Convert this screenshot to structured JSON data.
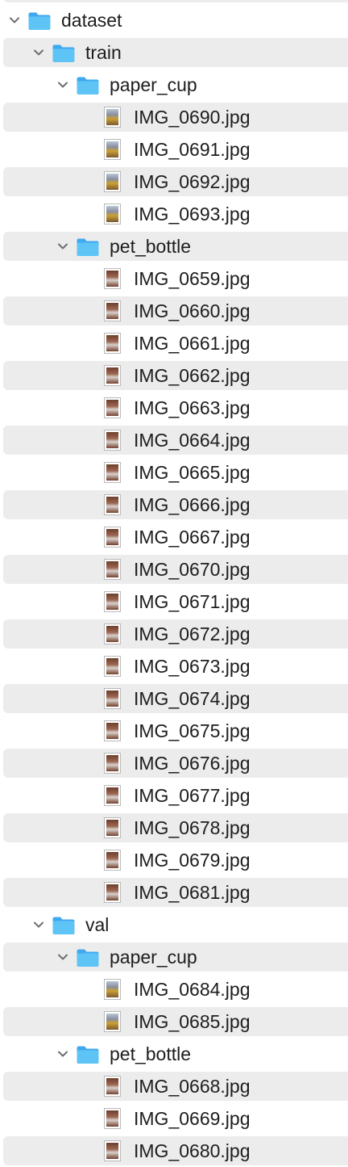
{
  "icons": {
    "folder": "folder-icon",
    "disclosure": "chevron-down-icon",
    "image": "image-thumbnail-icon"
  },
  "colors": {
    "folder": "#5ec4f5",
    "row_stripe": "#ececec",
    "text": "#1d1d1f"
  },
  "rows": [
    {
      "label": "dataset",
      "type": "folder",
      "depth": 0
    },
    {
      "label": "train",
      "type": "folder",
      "depth": 1
    },
    {
      "label": "paper_cup",
      "type": "folder",
      "depth": 2
    },
    {
      "label": "IMG_0690.jpg",
      "type": "file",
      "depth": 3,
      "thumb": "cup"
    },
    {
      "label": "IMG_0691.jpg",
      "type": "file",
      "depth": 3,
      "thumb": "cup"
    },
    {
      "label": "IMG_0692.jpg",
      "type": "file",
      "depth": 3,
      "thumb": "cup"
    },
    {
      "label": "IMG_0693.jpg",
      "type": "file",
      "depth": 3,
      "thumb": "cup"
    },
    {
      "label": "pet_bottle",
      "type": "folder",
      "depth": 2
    },
    {
      "label": "IMG_0659.jpg",
      "type": "file",
      "depth": 3,
      "thumb": "bottle"
    },
    {
      "label": "IMG_0660.jpg",
      "type": "file",
      "depth": 3,
      "thumb": "bottle"
    },
    {
      "label": "IMG_0661.jpg",
      "type": "file",
      "depth": 3,
      "thumb": "bottle"
    },
    {
      "label": "IMG_0662.jpg",
      "type": "file",
      "depth": 3,
      "thumb": "bottle"
    },
    {
      "label": "IMG_0663.jpg",
      "type": "file",
      "depth": 3,
      "thumb": "bottle"
    },
    {
      "label": "IMG_0664.jpg",
      "type": "file",
      "depth": 3,
      "thumb": "bottle"
    },
    {
      "label": "IMG_0665.jpg",
      "type": "file",
      "depth": 3,
      "thumb": "bottle"
    },
    {
      "label": "IMG_0666.jpg",
      "type": "file",
      "depth": 3,
      "thumb": "bottle"
    },
    {
      "label": "IMG_0667.jpg",
      "type": "file",
      "depth": 3,
      "thumb": "bottle"
    },
    {
      "label": "IMG_0670.jpg",
      "type": "file",
      "depth": 3,
      "thumb": "bottle"
    },
    {
      "label": "IMG_0671.jpg",
      "type": "file",
      "depth": 3,
      "thumb": "bottle"
    },
    {
      "label": "IMG_0672.jpg",
      "type": "file",
      "depth": 3,
      "thumb": "bottle"
    },
    {
      "label": "IMG_0673.jpg",
      "type": "file",
      "depth": 3,
      "thumb": "bottle"
    },
    {
      "label": "IMG_0674.jpg",
      "type": "file",
      "depth": 3,
      "thumb": "bottle"
    },
    {
      "label": "IMG_0675.jpg",
      "type": "file",
      "depth": 3,
      "thumb": "bottle"
    },
    {
      "label": "IMG_0676.jpg",
      "type": "file",
      "depth": 3,
      "thumb": "bottle"
    },
    {
      "label": "IMG_0677.jpg",
      "type": "file",
      "depth": 3,
      "thumb": "bottle"
    },
    {
      "label": "IMG_0678.jpg",
      "type": "file",
      "depth": 3,
      "thumb": "bottle"
    },
    {
      "label": "IMG_0679.jpg",
      "type": "file",
      "depth": 3,
      "thumb": "bottle"
    },
    {
      "label": "IMG_0681.jpg",
      "type": "file",
      "depth": 3,
      "thumb": "bottle"
    },
    {
      "label": "val",
      "type": "folder",
      "depth": 1
    },
    {
      "label": "paper_cup",
      "type": "folder",
      "depth": 2
    },
    {
      "label": "IMG_0684.jpg",
      "type": "file",
      "depth": 3,
      "thumb": "cup"
    },
    {
      "label": "IMG_0685.jpg",
      "type": "file",
      "depth": 3,
      "thumb": "cup"
    },
    {
      "label": "pet_bottle",
      "type": "folder",
      "depth": 2
    },
    {
      "label": "IMG_0668.jpg",
      "type": "file",
      "depth": 3,
      "thumb": "bottle"
    },
    {
      "label": "IMG_0669.jpg",
      "type": "file",
      "depth": 3,
      "thumb": "bottle"
    },
    {
      "label": "IMG_0680.jpg",
      "type": "file",
      "depth": 3,
      "thumb": "bottle"
    }
  ]
}
